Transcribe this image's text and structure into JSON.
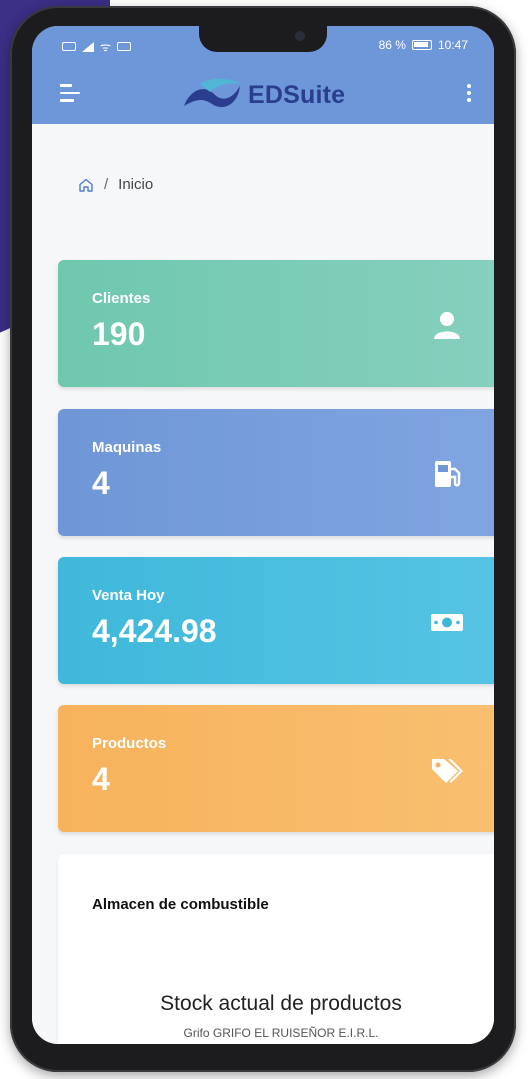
{
  "status_bar": {
    "battery_percent": "86 %",
    "time": "10:47"
  },
  "app_bar": {
    "logo_text": "EDSuite"
  },
  "breadcrumb": {
    "separator": "/",
    "current": "Inicio"
  },
  "cards": [
    {
      "label": "Clientes",
      "value": "190",
      "icon": "user-icon",
      "color": "#6fc7ae"
    },
    {
      "label": "Maquinas",
      "value": "4",
      "icon": "fuel-pump-icon",
      "color": "#6f96d6"
    },
    {
      "label": "Venta Hoy",
      "value": "4,424.98",
      "icon": "money-icon",
      "color": "#3fb8da"
    },
    {
      "label": "Productos",
      "value": "4",
      "icon": "tags-icon",
      "color": "#f7b25c"
    }
  ],
  "almacen": {
    "title": "Almacen de combustible",
    "chart_title": "Stock actual de productos",
    "chart_subtitle": "Grifo GRIFO EL RUISEÑOR E.I.R.L."
  },
  "colors": {
    "app_bar": "#6e97d9",
    "brand": "#2a3d8f"
  }
}
